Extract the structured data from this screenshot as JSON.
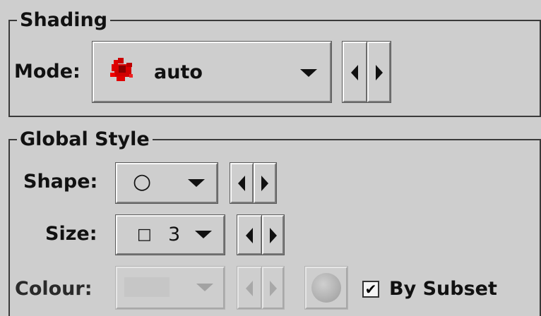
{
  "shading": {
    "title": "Shading",
    "mode_label": "Mode:",
    "mode_value": "auto",
    "mode_icon": "red-density-blob-icon",
    "accent_color": "#dd0000"
  },
  "global_style": {
    "title": "Global Style",
    "shape_label": "Shape:",
    "shape_value": "○",
    "size_label": "Size:",
    "size_value": "3",
    "size_icon": "□",
    "colour_label": "Colour:",
    "by_subset_label": "By Subset",
    "by_subset_checked": true,
    "check_mark": "✔"
  }
}
